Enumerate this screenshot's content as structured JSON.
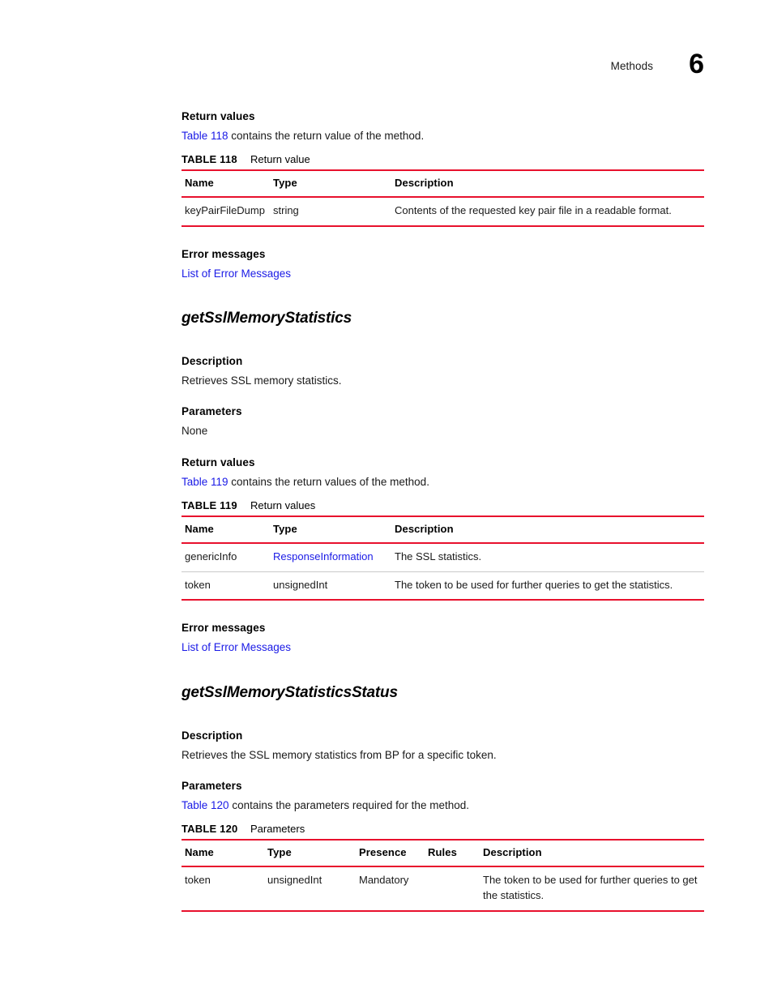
{
  "header": {
    "chapter_label": "Methods",
    "chapter_number": "6"
  },
  "sections": {
    "return_values_label": "Return values",
    "error_messages_label": "Error messages",
    "error_messages_link": "List of Error Messages",
    "description_label": "Description",
    "parameters_label": "Parameters"
  },
  "block1": {
    "intro_link": "Table 118",
    "intro_rest": " contains the return value of the method.",
    "table": {
      "number": "TABLE 118",
      "title": "Return value",
      "columns": [
        "Name",
        "Type",
        "Description"
      ],
      "rows": [
        {
          "name": "keyPairFileDump",
          "type": "string",
          "description": "Contents of the requested key pair file in a readable format."
        }
      ]
    }
  },
  "method1": {
    "name": "getSslMemoryStatistics",
    "description": "Retrieves SSL memory statistics.",
    "parameters_value": "None",
    "intro_link": "Table 119",
    "intro_rest": " contains the return values of the method.",
    "table": {
      "number": "TABLE 119",
      "title": "Return values",
      "columns": [
        "Name",
        "Type",
        "Description"
      ],
      "rows": [
        {
          "name": "genericInfo",
          "type": "ResponseInformation",
          "type_is_link": true,
          "description": "The SSL statistics."
        },
        {
          "name": "token",
          "type": "unsignedInt",
          "type_is_link": false,
          "description": "The token to be used for further queries to get the statistics."
        }
      ]
    }
  },
  "method2": {
    "name": "getSslMemoryStatisticsStatus",
    "description": "Retrieves the SSL memory statistics from BP for a specific token.",
    "intro_link": "Table 120",
    "intro_rest": " contains the parameters required for the method.",
    "table": {
      "number": "TABLE 120",
      "title": "Parameters",
      "columns": [
        "Name",
        "Type",
        "Presence",
        "Rules",
        "Description"
      ],
      "rows": [
        {
          "name": "token",
          "type": "unsignedInt",
          "presence": "Mandatory",
          "rules": "",
          "description": "The token to be used for further queries to get the statistics."
        }
      ]
    }
  },
  "colors": {
    "rule_red": "#e8112d",
    "link_blue": "#1a1ae6"
  }
}
